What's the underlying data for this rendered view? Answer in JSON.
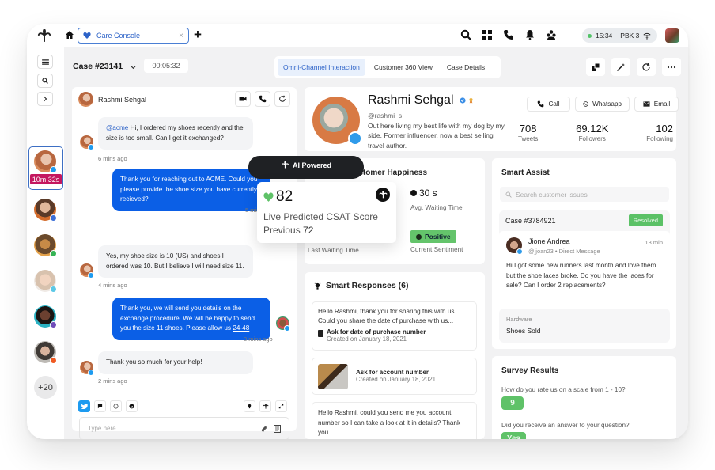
{
  "topbar": {
    "tab_label": "Care Console",
    "tab_close": "×",
    "new_tab": "+",
    "status": {
      "time": "15:34",
      "station": "PBK 3"
    }
  },
  "case": {
    "title": "Case #23141",
    "timer": "00:05:32",
    "tabs": [
      {
        "label": "Omni-Channel Interaction",
        "active": true
      },
      {
        "label": "Customer 360 View",
        "active": false
      },
      {
        "label": "Case Details",
        "active": false
      }
    ]
  },
  "rail": {
    "active_timer": "10m 32s",
    "more_count": "+20",
    "conversations": [
      {
        "channel": "twitter",
        "color": "#1d9bf0"
      },
      {
        "channel": "facebook",
        "color": "#3b6fd8"
      },
      {
        "channel": "whatsapp",
        "color": "#36b455"
      },
      {
        "channel": "messenger",
        "color": "#5bc8e6"
      },
      {
        "channel": "viber",
        "color": "#6f4bb8"
      },
      {
        "channel": "reddit",
        "color": "#f05a22"
      }
    ]
  },
  "chat": {
    "contact_name": "Rashmi Sehgal",
    "messages": [
      {
        "direction": "in",
        "mention": "@acme",
        "text": " Hi, I ordered my shoes recently and the size is too small. Can I get it exchanged?",
        "time": "6 mins ago"
      },
      {
        "direction": "out",
        "text": "Thank you for reaching out to ACME. Could you please provide the shoe size you have currently recieved?",
        "time": "5 mins ago"
      },
      {
        "direction": "in",
        "text": "Yes, my shoe size is 10 (US) and shoes I ordered was 10. But I believe I will need size 11.",
        "time": "4 mins ago"
      },
      {
        "direction": "out",
        "text": "Thank you, we will send you details on the exchange procedure. We will be happy to send you the size 11 shoes. Please allow us ",
        "link": "24-48",
        "time": "3 mins ago"
      },
      {
        "direction": "in",
        "text": "Thank you so much for your help!",
        "time": "2 mins ago"
      }
    ],
    "composer_placeholder": "Type here..."
  },
  "profile": {
    "name": "Rashmi Sehgal",
    "handle": "@rashmi_s",
    "bio": "Out here living my best life with my dog by my side. Former influencer, now a best selling travel author.",
    "buttons": {
      "call": "Call",
      "whatsapp": "Whatsapp",
      "email": "Email"
    },
    "stats": [
      {
        "value": "708",
        "label": "Tweets"
      },
      {
        "value": "69.12K",
        "label": "Followers"
      },
      {
        "value": "102",
        "label": "Following"
      }
    ]
  },
  "happiness": {
    "title": "Customer Happiness",
    "avg_wait_value": "30 s",
    "avg_wait_label": "Avg. Waiting Time",
    "last_wait_label": "Last Waiting Time",
    "sentiment": "Positive",
    "sentiment_label": "Current Sentiment"
  },
  "ai": {
    "pill_label": "AI Powered",
    "csat_score": "82",
    "csat_label": "Live Predicted CSAT Score",
    "previous_label": "Previous",
    "previous_value": "72"
  },
  "smart_responses": {
    "title": "Smart Responses (6)",
    "items": [
      {
        "text": "Hello Rashmi, thank you for sharing this with us. Could you share the date of purchase with us...",
        "title": "Ask for date of purchase number",
        "created": "Created on January 18, 2021"
      },
      {
        "title": "Ask for account number",
        "created": "Created on January 18, 2021"
      },
      {
        "text": "Hello Rashmi, could you send me you account number so I can take a look at it in details? Thank you."
      }
    ]
  },
  "smart_assist": {
    "title": "Smart Assist",
    "search_placeholder": "Search customer issues",
    "case_id": "Case #3784921",
    "case_status": "Resolved",
    "message": {
      "name": "Jione Andrea",
      "handle": "@jjoan23 • Direct Message",
      "time": "13 min",
      "text": "Hi I got some new runners last month and love them but the shoe laces broke. Do you have the laces for sale? Can I order 2 replacements?"
    },
    "category_label": "Hardware",
    "category_value": "Shoes Sold"
  },
  "survey": {
    "title": "Survey Results",
    "q1": "How do you rate us on a scale from 1 - 10?",
    "a1": "9",
    "q2": "Did you receive an answer to your question?",
    "a2": "Yes"
  },
  "colors": {
    "accent": "#2d63c8",
    "outgoing_bubble": "#0b5fe6",
    "positive": "#5fc268",
    "timer_badge": "#c4175f"
  }
}
